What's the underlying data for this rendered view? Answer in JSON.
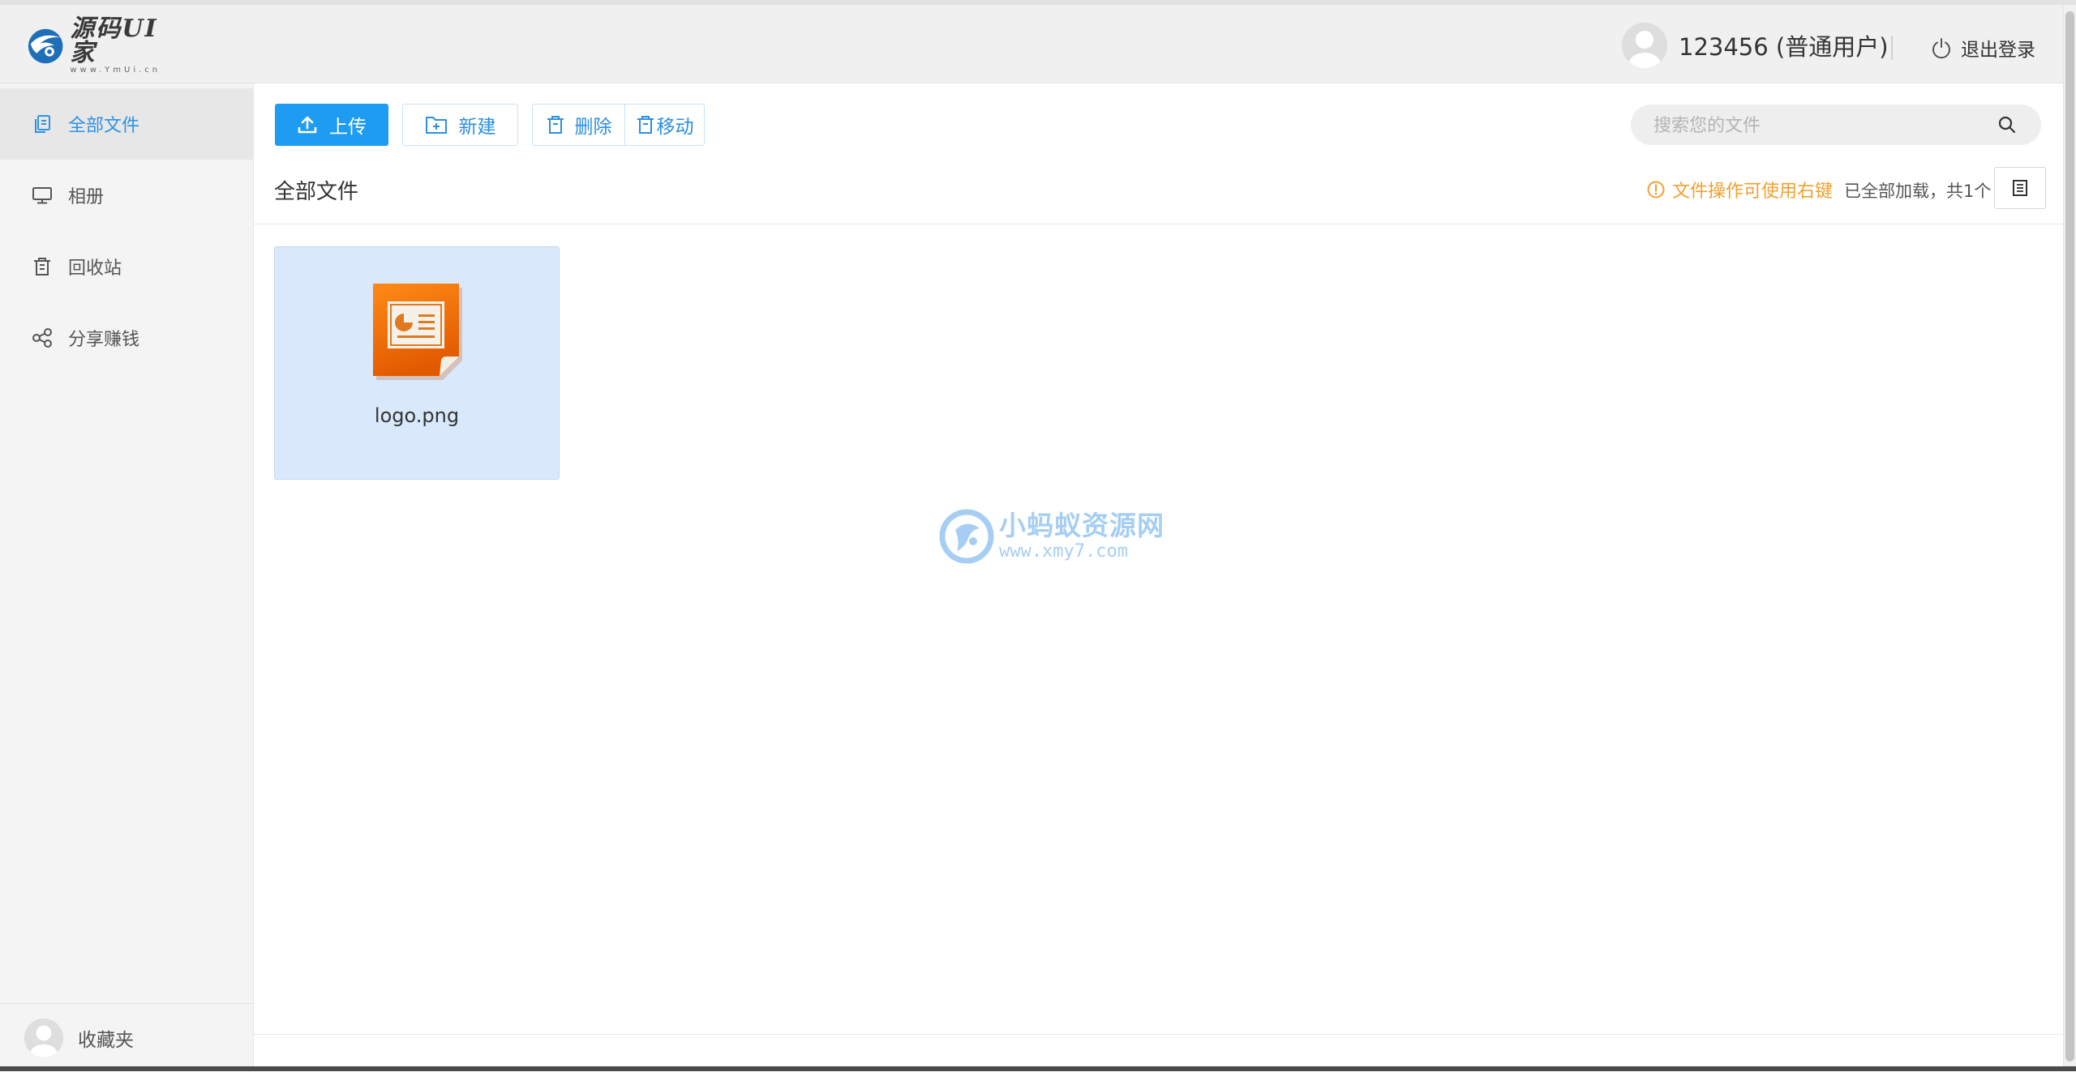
{
  "app": {
    "logo_text": "源码UI家",
    "logo_subtext": "www.YmUi.cn"
  },
  "header": {
    "user_name": "123456 (普通用户)",
    "logout_label": "退出登录"
  },
  "sidebar": {
    "items": [
      {
        "label": "全部文件",
        "icon": "copy-icon",
        "active": true
      },
      {
        "label": "相册",
        "icon": "monitor-icon",
        "active": false
      },
      {
        "label": "回收站",
        "icon": "trash-icon",
        "active": false
      },
      {
        "label": "分享赚钱",
        "icon": "share-icon",
        "active": false
      }
    ],
    "favorites_label": "收藏夹"
  },
  "toolbar": {
    "upload_label": "上传",
    "new_label": "新建",
    "delete_label": "删除",
    "move_label": "移动"
  },
  "search": {
    "placeholder": "搜索您的文件",
    "value": ""
  },
  "content": {
    "breadcrumb": "全部文件",
    "tip": "文件操作可使用右键",
    "count_text": "已全部加载，共1个"
  },
  "files": [
    {
      "name": "logo.png",
      "icon": "presentation-file-icon"
    }
  ],
  "watermark": {
    "text": "小蚂蚁资源网",
    "url": "www.xmy7.com"
  },
  "colors": {
    "accent": "#1e9cf1",
    "active_nav_text": "#2d92e5",
    "tip": "#f0a030",
    "file_selected_bg": "#d9e9fb"
  }
}
